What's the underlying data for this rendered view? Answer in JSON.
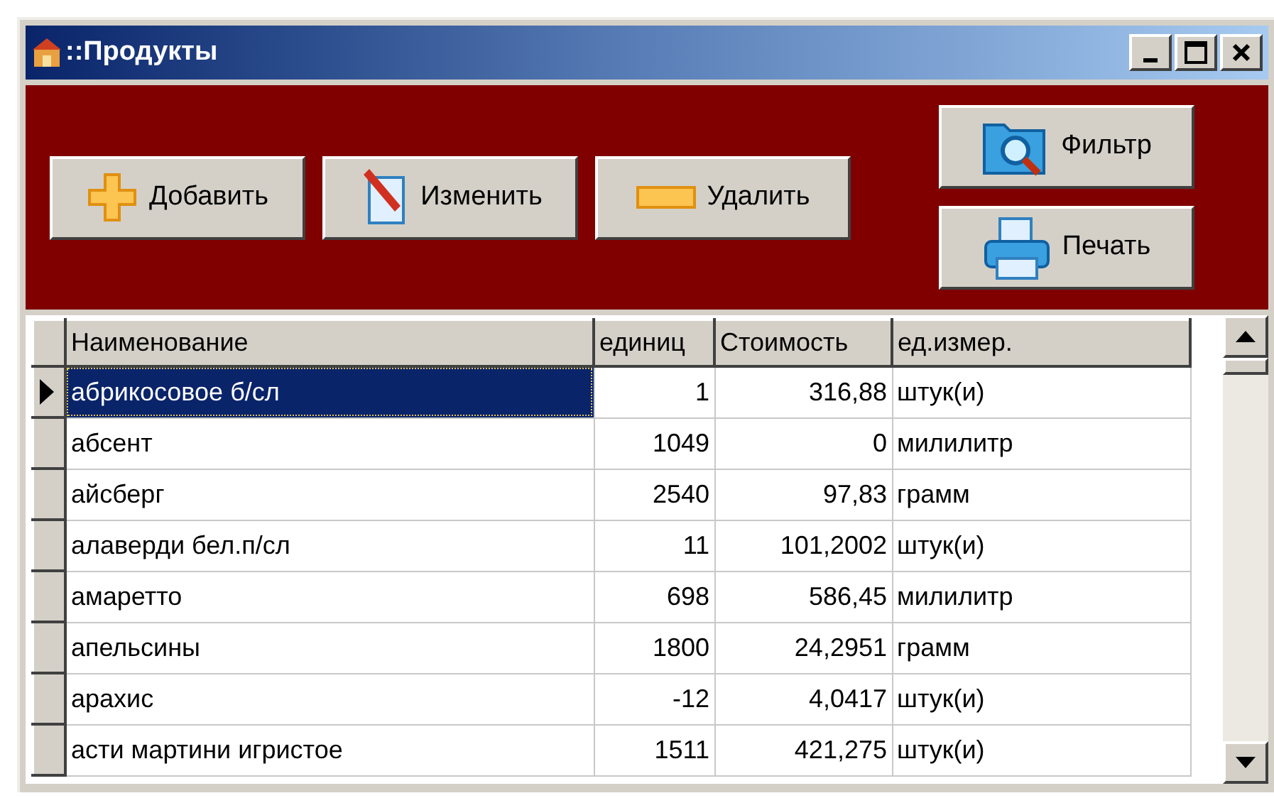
{
  "window": {
    "title": "::Продукты"
  },
  "toolbar": {
    "buttons": [
      {
        "label": "Добавить",
        "kind": "add"
      },
      {
        "label": "Изменить",
        "kind": "edit"
      },
      {
        "label": "Удалить",
        "kind": "delete"
      },
      {
        "label": "Фильтр",
        "kind": "filter"
      },
      {
        "label": "Печать",
        "kind": "print"
      }
    ]
  },
  "table": {
    "columns": [
      "Наименование",
      "единиц",
      "Стоимость",
      "ед.измер."
    ],
    "rows": [
      {
        "selected": true,
        "cells": [
          "абрикосовое б/сл",
          "1",
          "316,88",
          "штук(и)"
        ]
      },
      {
        "selected": false,
        "cells": [
          "абсент",
          "1049",
          "0",
          "милилитр"
        ]
      },
      {
        "selected": false,
        "cells": [
          "айсберг",
          "2540",
          "97,83",
          "грамм"
        ]
      },
      {
        "selected": false,
        "cells": [
          "алаверди бел.п/сл",
          "11",
          "101,2002",
          "штук(и)"
        ]
      },
      {
        "selected": false,
        "cells": [
          "амаретто",
          "698",
          "586,45",
          "милилитр"
        ]
      },
      {
        "selected": false,
        "cells": [
          "апельсины",
          "1800",
          "24,2951",
          "грамм"
        ]
      },
      {
        "selected": false,
        "cells": [
          "арахис",
          "-12",
          "4,0417",
          "штук(и)"
        ]
      },
      {
        "selected": false,
        "cells": [
          "асти мартини игристое",
          "1511",
          "421,275",
          "штук(и)"
        ]
      }
    ]
  }
}
